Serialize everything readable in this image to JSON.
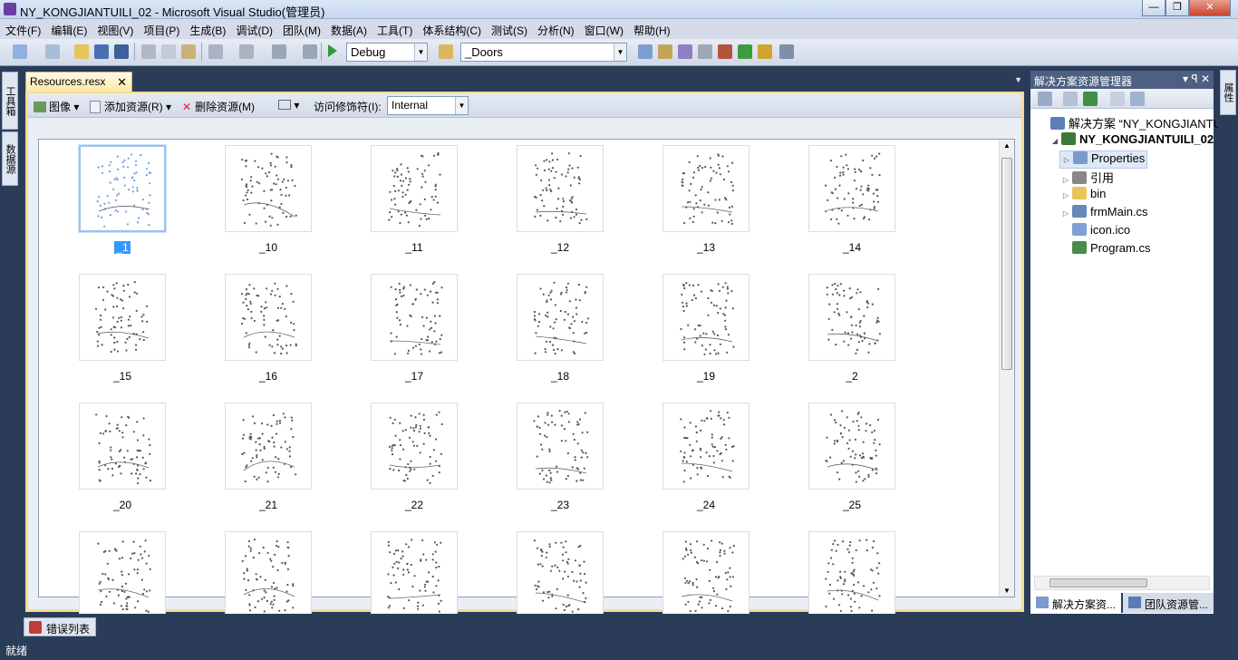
{
  "window": {
    "title": "NY_KONGJIANTUILI_02 - Microsoft Visual Studio(管理员)",
    "min": "—",
    "max": "❐",
    "close": "✕"
  },
  "menu": [
    "文件(F)",
    "编辑(E)",
    "视图(V)",
    "项目(P)",
    "生成(B)",
    "调试(D)",
    "团队(M)",
    "数据(A)",
    "工具(T)",
    "体系结构(C)",
    "测试(S)",
    "分析(N)",
    "窗口(W)",
    "帮助(H)"
  ],
  "toolbar": {
    "config": "Debug",
    "search": "_Doors"
  },
  "left_tabs": [
    "工具箱",
    "数据源"
  ],
  "right_tabs": [
    "属性"
  ],
  "document": {
    "tab_label": "Resources.resx",
    "resource_toolbar": {
      "image_label": "图像",
      "add_label": "添加资源(R)",
      "remove_label": "删除资源(M)",
      "access_label": "访问修饰符(I):",
      "access_value": "Internal"
    },
    "resources": [
      "_1",
      "_10",
      "_11",
      "_12",
      "_13",
      "_14",
      "_15",
      "_16",
      "_17",
      "_18",
      "_19",
      "_2",
      "_20",
      "_21",
      "_22",
      "_23",
      "_24",
      "_25",
      "",
      "",
      "",
      "",
      "",
      ""
    ],
    "selected": "_1"
  },
  "solution": {
    "header": "解决方案资源管理器",
    "header_controls": "▾ ꟼ ✕",
    "items": [
      {
        "label": "解决方案 “NY_KONGJIANTUI",
        "indent": 0,
        "expander": "",
        "icon": "#5b7fb8",
        "bold": false
      },
      {
        "label": "NY_KONGJIANTUILI_02",
        "indent": 1,
        "expander": "◢",
        "icon": "#3a7a3a",
        "bold": true
      },
      {
        "label": "Properties",
        "indent": 2,
        "expander": "▷",
        "icon": "#7a9ccc",
        "bold": false
      },
      {
        "label": "引用",
        "indent": 2,
        "expander": "▷",
        "icon": "#888888",
        "bold": false
      },
      {
        "label": "bin",
        "indent": 2,
        "expander": "▷",
        "icon": "#e8c55a",
        "bold": false
      },
      {
        "label": "frmMain.cs",
        "indent": 2,
        "expander": "▷",
        "icon": "#6688bb",
        "bold": false
      },
      {
        "label": "icon.ico",
        "indent": 2,
        "expander": "",
        "icon": "#7ea0d6",
        "bold": false
      },
      {
        "label": "Program.cs",
        "indent": 2,
        "expander": "",
        "icon": "#4a8a4a",
        "bold": false
      }
    ],
    "bottom_tabs": [
      "解决方案资...",
      "团队资源管..."
    ]
  },
  "error_tab": "错误列表",
  "status": "就绪"
}
